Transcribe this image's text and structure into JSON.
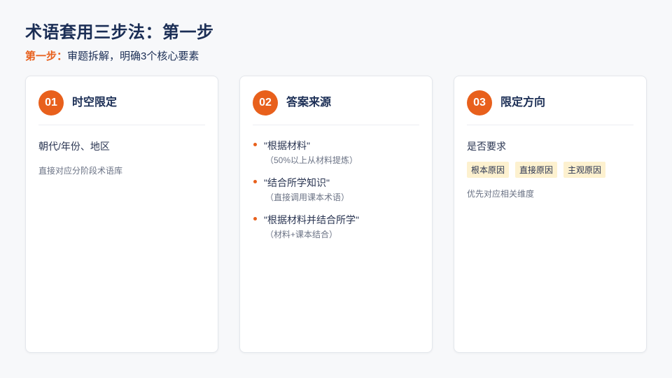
{
  "header": {
    "title": "术语套用三步法：第一步",
    "subtitle_prefix": "第一步：",
    "subtitle_text": "审题拆解，明确3个核心要素"
  },
  "cards": [
    {
      "number": "01",
      "title": "时空限定",
      "main": "朝代/年份、地区",
      "note": "直接对应分阶段术语库"
    },
    {
      "number": "02",
      "title": "答案来源",
      "bullets": [
        {
          "main": "\"根据材料\"",
          "sub": "（50%以上从材料提炼）"
        },
        {
          "main": "\"结合所学知识\"",
          "sub": "（直接调用课本术语）"
        },
        {
          "main": "\"根据材料并结合所学\"",
          "sub": "（材料+课本结合）"
        }
      ]
    },
    {
      "number": "03",
      "title": "限定方向",
      "main": "是否要求",
      "tags": [
        "根本原因",
        "直接原因",
        "主观原因"
      ],
      "note": "优先对应相关维度"
    }
  ],
  "colors": {
    "accent": "#e8601c",
    "title": "#1b2e55",
    "tag_bg": "#fdf1cf",
    "background": "#f7f8fa"
  }
}
